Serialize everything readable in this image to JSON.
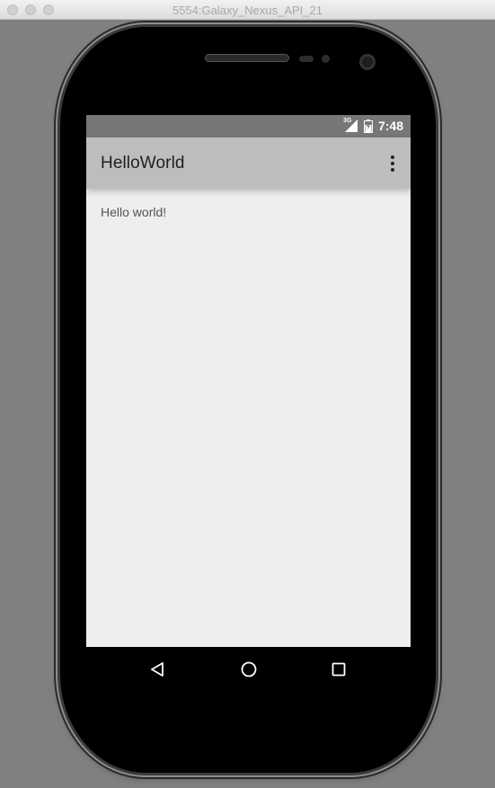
{
  "window": {
    "title": "5554:Galaxy_Nexus_API_21"
  },
  "statusbar": {
    "network": "3G",
    "time": "7:48"
  },
  "appbar": {
    "title": "HelloWorld",
    "overflow_icon": "more-vert-icon"
  },
  "content": {
    "text": "Hello world!"
  },
  "navbar": {
    "back_icon": "back-icon",
    "home_icon": "home-icon",
    "recents_icon": "recents-icon"
  },
  "colors": {
    "statusbar": "#777777",
    "appbar": "#bdbdbd",
    "screen_bg": "#eeeeee",
    "navbar": "#000000"
  }
}
